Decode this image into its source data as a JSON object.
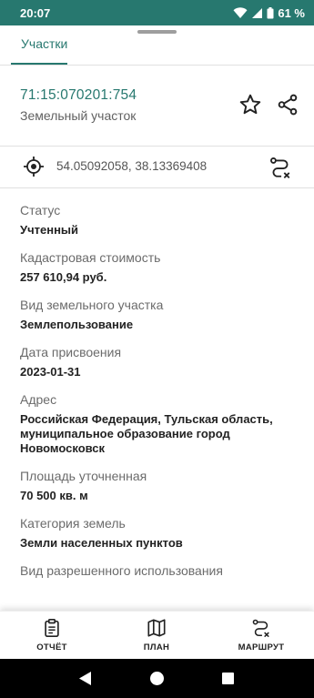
{
  "status_bar": {
    "time": "20:07",
    "battery": "61 %"
  },
  "tabs": [
    {
      "label": "Участки"
    }
  ],
  "parcel": {
    "cadastral_number": "71:15:070201:754",
    "type": "Земельный участок"
  },
  "coordinates": {
    "text": "54.05092058, 38.13369408"
  },
  "properties": [
    {
      "label": "Статус",
      "value": "Учтенный"
    },
    {
      "label": "Кадастровая стоимость",
      "value": "257 610,94 руб."
    },
    {
      "label": "Вид земельного участка",
      "value": "Землепользование"
    },
    {
      "label": "Дата присвоения",
      "value": "2023-01-31"
    },
    {
      "label": "Адрес",
      "value": "Российская Федерация, Тульская область, муниципальное образование город Новомосковск"
    },
    {
      "label": "Площадь уточненная",
      "value": "70 500 кв. м"
    },
    {
      "label": "Категория земель",
      "value": "Земли населенных пунктов"
    },
    {
      "label": "Вид разрешенного использования",
      "value": ""
    }
  ],
  "bottom_nav": {
    "report_label": "ОТЧЁТ",
    "plan_label": "ПЛАН",
    "route_label": "МАРШРУТ"
  },
  "colors": {
    "accent": "#27786f",
    "status_bar": "#27786f"
  },
  "icons": {
    "status_bar": [
      "wifi-icon",
      "signal-icon",
      "battery-icon"
    ],
    "header": [
      "star-icon",
      "share-icon"
    ],
    "coordinates": [
      "crosshair-icon",
      "route-icon"
    ],
    "bottom_nav": [
      "clipboard-icon",
      "map-icon",
      "route-icon"
    ]
  }
}
